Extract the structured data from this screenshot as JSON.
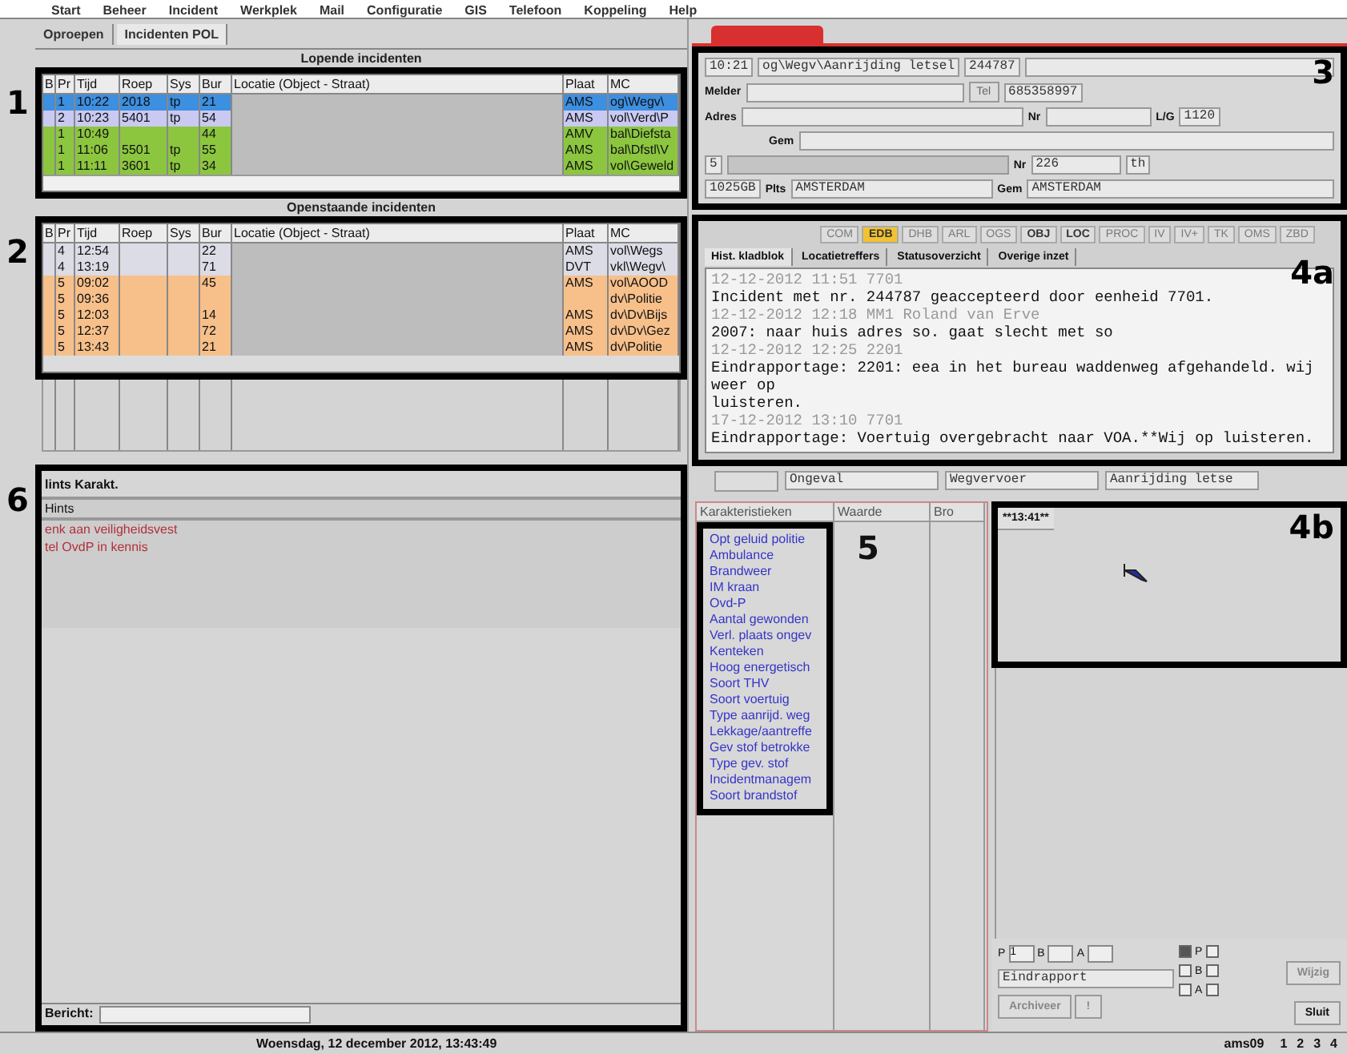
{
  "menu": [
    "Start",
    "Beheer",
    "Incident",
    "Werkplek",
    "Mail",
    "Configuratie",
    "GIS",
    "Telefoon",
    "Koppeling",
    "Help"
  ],
  "left_tabs": [
    {
      "label": "Oproepen",
      "selected": false
    },
    {
      "label": "Incidenten POL",
      "selected": true
    }
  ],
  "lopende": {
    "title": "Lopende incidenten",
    "columns": [
      "B",
      "Pr",
      "Tijd",
      "Roep",
      "Sys",
      "Bur",
      "Locatie (Object - Straat)",
      "Plaat",
      "MC"
    ],
    "rows": [
      {
        "pr": "1",
        "tijd": "10:22",
        "roep": "2018",
        "sys": "tp",
        "bur": "21",
        "plaats": "AMS",
        "mc": "og\\Wegv\\",
        "selected": true
      },
      {
        "pr": "2",
        "tijd": "10:23",
        "roep": "5401",
        "sys": "tp",
        "bur": "54",
        "plaats": "AMS",
        "mc": "vol\\Verd\\P",
        "color": "#c9c9f2",
        "selected": false
      },
      {
        "pr": "1",
        "tijd": "10:49",
        "bur": "44",
        "plaats": "AMV",
        "mc": "bal\\Diefsta",
        "color": "#8cc63f",
        "selected": false
      },
      {
        "pr": "1",
        "tijd": "11:06",
        "roep": "5501",
        "sys": "tp",
        "bur": "55",
        "plaats": "AMS",
        "mc": "bal\\Dfstl\\V",
        "color": "#8cc63f",
        "selected": false
      },
      {
        "pr": "1",
        "tijd": "11:11",
        "roep": "3601",
        "sys": "tp",
        "bur": "34",
        "plaats": "AMS",
        "mc": "vol\\Geweld",
        "color": "#8cc63f",
        "selected": false
      }
    ]
  },
  "openstaande": {
    "title": "Openstaande incidenten",
    "columns": [
      "B",
      "Pr",
      "Tijd",
      "Roep",
      "Sys",
      "Bur",
      "Locatie (Object - Straat)",
      "Plaat",
      "MC"
    ],
    "rows": [
      {
        "pr": "4",
        "tijd": "12:54",
        "bur": "22",
        "plaats": "AMS",
        "mc": "vol\\Wegs",
        "color": "#dcdce6",
        "selected": false
      },
      {
        "pr": "4",
        "tijd": "13:19",
        "bur": "71",
        "plaats": "DVT",
        "mc": "vkl\\Wegv\\",
        "color": "#dcdce6",
        "selected": false
      },
      {
        "pr": "5",
        "tijd": "09:02",
        "bur": "45",
        "plaats": "AMS",
        "mc": "vol\\AOOD",
        "color": "#f7c08a",
        "selected": false
      },
      {
        "pr": "5",
        "tijd": "09:36",
        "mc": "dv\\Politie",
        "color": "#f7c08a",
        "selected": false
      },
      {
        "pr": "5",
        "tijd": "12:03",
        "bur": "14",
        "plaats": "AMS",
        "mc": "dv\\Dv\\Bijs",
        "color": "#f7c08a",
        "selected": false
      },
      {
        "pr": "5",
        "tijd": "12:37",
        "bur": "72",
        "plaats": "AMS",
        "mc": "dv\\Dv\\Gez",
        "color": "#f7c08a",
        "selected": false
      },
      {
        "pr": "5",
        "tijd": "13:43",
        "bur": "21",
        "plaats": "AMS",
        "mc": "dv\\Politie",
        "color": "#f7c08a",
        "selected": false
      }
    ]
  },
  "hints": {
    "tab": "lints Karakt.",
    "header": "Hints",
    "items": [
      "enk aan veiligheidsvest",
      "tel OvdP in kennis"
    ],
    "footer_label": "Bericht:"
  },
  "incident": {
    "summary": [
      "10:21",
      "og\\Wegv\\Aanrijding letsel",
      "244787"
    ],
    "melder_label": "Melder",
    "tel_label": "Tel",
    "tel": "685358997",
    "adres_label": "Adres",
    "nr_label": "Nr",
    "lg_label": "L/G",
    "lg": "1120",
    "gem_label": "Gem",
    "loc_prefix": "5",
    "loc_nr_label": "Nr",
    "loc_nr": "226",
    "loc_suffix": "th",
    "postcode": "1025GB",
    "plts_label": "Plts",
    "plaats": "AMSTERDAM",
    "gem_label2": "Gem",
    "gem": "AMSTERDAM"
  },
  "source_buttons": [
    {
      "label": "COM",
      "disabled": true,
      "selected": false
    },
    {
      "label": "EDB",
      "disabled": false,
      "selected": true
    },
    {
      "label": "DHB",
      "disabled": true,
      "selected": false
    },
    {
      "label": "ARL",
      "disabled": true,
      "selected": false
    },
    {
      "label": "OGS",
      "disabled": true,
      "selected": false
    },
    {
      "label": "OBJ",
      "disabled": false,
      "selected": false
    },
    {
      "label": "LOC",
      "disabled": false,
      "selected": false
    },
    {
      "label": "PROC",
      "disabled": true,
      "selected": false
    },
    {
      "label": "IV",
      "disabled": true,
      "selected": false
    },
    {
      "label": "IV+",
      "disabled": true,
      "selected": false
    },
    {
      "label": "TK",
      "disabled": true,
      "selected": false
    },
    {
      "label": "OMS",
      "disabled": true,
      "selected": false
    },
    {
      "label": "ZBD",
      "disabled": true,
      "selected": false
    }
  ],
  "log_tabs": [
    {
      "label": "Hist. kladblok",
      "selected": true
    },
    {
      "label": "Locatietreffers",
      "selected": false
    },
    {
      "label": "Statusoverzicht",
      "selected": false
    },
    {
      "label": "Overige inzet",
      "selected": false
    }
  ],
  "log": [
    {
      "kind": "stamp",
      "text": "12-12-2012 11:51 7701"
    },
    {
      "kind": "entry",
      "text": "Incident met nr. 244787 geaccepteerd door eenheid 7701."
    },
    {
      "kind": "stamp",
      "text": "12-12-2012 12:18 MM1 Roland van Erve"
    },
    {
      "kind": "entry",
      "text": "2007: naar huis adres so. gaat slecht met so"
    },
    {
      "kind": "stamp",
      "text": "12-12-2012 12:25 2201"
    },
    {
      "kind": "entry",
      "text": "Eindrapportage: 2201: eea in het bureau waddenweg afgehandeld. wij weer op\nluisteren."
    },
    {
      "kind": "stamp",
      "text": "17-12-2012 13:10 7701"
    },
    {
      "kind": "entry",
      "text": "Eindrapportage: Voertuig overgebracht naar VOA.**Wij op luisteren."
    }
  ],
  "classification": [
    "Ongeval",
    "Wegvervoer",
    "Aanrijding letse"
  ],
  "karakteristieken": {
    "columns": [
      "Karakteristieken",
      "Waarde",
      "Bro"
    ],
    "items": [
      "Opt geluid politie",
      "Ambulance",
      "Brandweer",
      "IM kraan",
      "Ovd-P",
      "Aantal gewonden",
      "Verl. plaats ongev",
      "Kenteken",
      "Hoog energetisch",
      "Soort THV",
      "Soort voertuig",
      "Type aanrijd. weg",
      "Lekkage/aantreffe",
      "Gev stof betrokke",
      "Type gev. stof",
      "Incidentmanagem",
      "Soort brandstof"
    ]
  },
  "note": {
    "header": "**13:41**"
  },
  "priority": [
    {
      "label": "P",
      "value": "1"
    },
    {
      "label": "B"
    },
    {
      "label": "A"
    }
  ],
  "flags": [
    {
      "label": "P",
      "left": true,
      "right": false
    },
    {
      "label": "B",
      "left": false,
      "right": false
    },
    {
      "label": "A",
      "left": false,
      "right": false
    }
  ],
  "status_select": "Eindrapport",
  "actions": [
    {
      "label": "Archiveer",
      "disabled": true
    },
    {
      "label": "!",
      "disabled": true
    },
    {
      "label": "Wijzig",
      "disabled": true
    },
    {
      "label": "Sluit",
      "disabled": false
    }
  ],
  "status_bar": {
    "datetime": "Woensdag, 12 december 2012, 13:43:49",
    "user": "ams09",
    "pages": [
      "1",
      "2",
      "3",
      "4"
    ]
  },
  "annotations": [
    "1",
    "2",
    "3",
    "4a",
    "4b",
    "5",
    "6"
  ]
}
